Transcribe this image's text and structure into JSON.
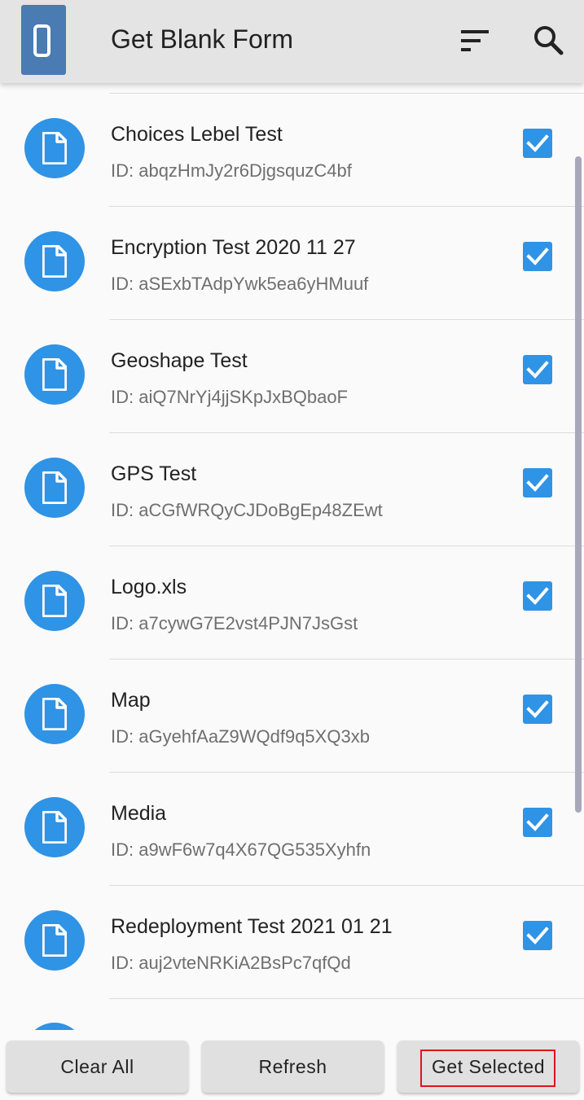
{
  "header": {
    "title": "Get Blank Form",
    "logo_icon": "odk-collect-logo-icon",
    "sort_icon": "sort-icon",
    "search_icon": "search-icon"
  },
  "forms": [
    {
      "title": "Choices Lebel Test",
      "id": "ID: abqzHmJy2r6DjgsquzC4bf",
      "checked": true
    },
    {
      "title": "Encryption Test 2020 11 27",
      "id": "ID: aSExbTAdpYwk5ea6yHMuuf",
      "checked": true
    },
    {
      "title": "Geoshape Test",
      "id": "ID: aiQ7NrYj4jjSKpJxBQbaoF",
      "checked": true
    },
    {
      "title": "GPS Test",
      "id": "ID: aCGfWRQyCJDoBgEp48ZEwt",
      "checked": true
    },
    {
      "title": "Logo.xls",
      "id": "ID: a7cywG7E2vst4PJN7JsGst",
      "checked": true
    },
    {
      "title": "Map",
      "id": "ID: aGyehfAaZ9WQdf9q5XQ3xb",
      "checked": true
    },
    {
      "title": "Media",
      "id": "ID: a9wF6w7q4X67QG535Xyhfn",
      "checked": true
    },
    {
      "title": "Redeployment Test 2021 01 21",
      "id": "ID: auj2vteNRKiA2BsPc7qfQd",
      "checked": true
    }
  ],
  "buttons": {
    "clear_all": "Clear All",
    "refresh": "Refresh",
    "get_selected": "Get Selected"
  },
  "colors": {
    "accent": "#2f93e6",
    "app_bar": "#e4e4e4",
    "highlight": "#e0141e"
  }
}
